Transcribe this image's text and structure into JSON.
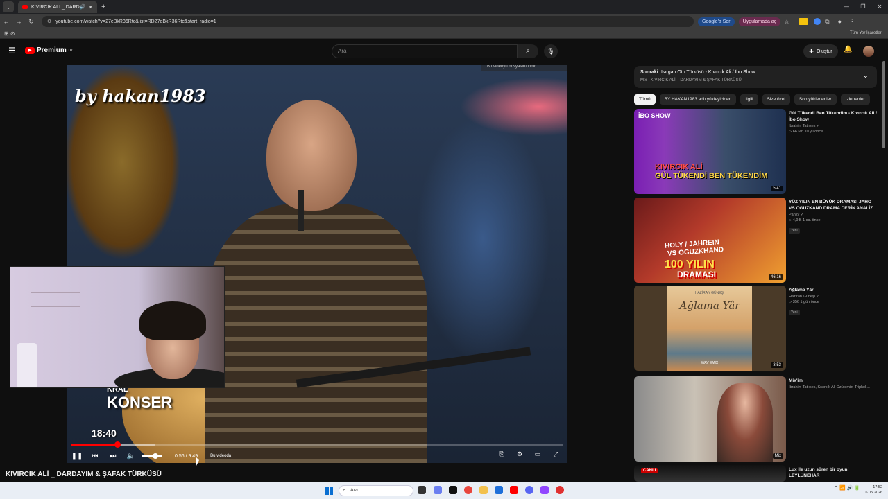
{
  "browser": {
    "tab_title": "KIVIRCIK ALİ _ DARDAYIM &",
    "url": "youtube.com/watch?v=27eBkR36Rtc&list=RD27eBkR36Rtc&start_radio=1",
    "google_pill": "Google'a Sor",
    "app_pill": "Uygulamada aç",
    "all_bookmarks": "Tüm Yer İşaretleri"
  },
  "header": {
    "logo": "Premium",
    "logo_sup": "TR",
    "search_placeholder": "Ara",
    "create_label": "Oluştur"
  },
  "player": {
    "watermark": "by hakan1983",
    "konser_small": "KRAL",
    "konser_big": "KONSER",
    "clock_overlay": "18:40",
    "download_overlay": "Bu videoyu dosyasını indir",
    "time": "0:56 / 9:49",
    "chapter": "Bu videoda",
    "progress_fraction": 0.095,
    "buffered_fraction": 0.17
  },
  "video_title": "KIVIRCIK ALİ _ DARDAYIM & ŞAFAK TÜRKÜSÜ",
  "up_next": {
    "prefix": "Sonraki:",
    "title": "Isırgan Otu Türküsü - Kıvırcık Ali / İbo Show",
    "mix": "Mix - KIVIRCIK ALİ _ DARDAYIM & ŞAFAK TÜRKÜSÜ"
  },
  "chips": [
    "Tümü",
    "BY HAKAN1983 adlı yükleyiciden",
    "İlgili",
    "Size özel",
    "Son yüklenenler",
    "İzlenenler"
  ],
  "recommendations": [
    {
      "title": "Gül Tükendi Ben Tükendim - Kıvırcık Ali / İbo Show",
      "channel": "İbrahim Tatlıses ✓",
      "stats": "▷ 66 Mn  10 yıl önce",
      "badge": "",
      "duration": "5:41",
      "thumb_ibo": "İBO SHOW",
      "thumb_l1": "KIVIRCIK ALİ",
      "thumb_l2": "GÜL TÜKENDİ BEN TÜKENDİM"
    },
    {
      "title": "YÜZ YILIN EN BÜYÜK DRAMASI JAHO VS OGUZKAND DRAMA DERİN ANALİZ",
      "channel": "Panky ✓",
      "stats": "▷ 4,9 B  1 sa. önce",
      "badge": "Yeni",
      "duration": "46:16",
      "thumb_l1": "HOLY / JAHREIN",
      "thumb_l2": "VS OGUZKHAND",
      "thumb_l3": "100 YILIN",
      "thumb_l4": "DRAMASI"
    },
    {
      "title": "Ağlama Yâr",
      "channel": "Haziran Güneşi ✓",
      "stats": "▷ 356  1 gün önce",
      "badge": "Yeni",
      "duration": "3:53",
      "thumb_top": "HAZİRAN GÜNEŞİ",
      "thumb_script": "Ağlama Yâr",
      "thumb_bottom": "WAV EMIX"
    },
    {
      "title": "Mix'im",
      "channel": "İbrahim Tatlıses, Kıvırcık Ali Özütemiz, Tripkoli...",
      "stats": "",
      "badge": "",
      "duration": "Mix"
    },
    {
      "title": "Lux ile uzun süren bir oyun! | LEYLÜNEHAR",
      "live": "CANLI"
    }
  ],
  "taskbar": {
    "search": "Ara",
    "time": "17:52",
    "date": "6.05.2026"
  }
}
